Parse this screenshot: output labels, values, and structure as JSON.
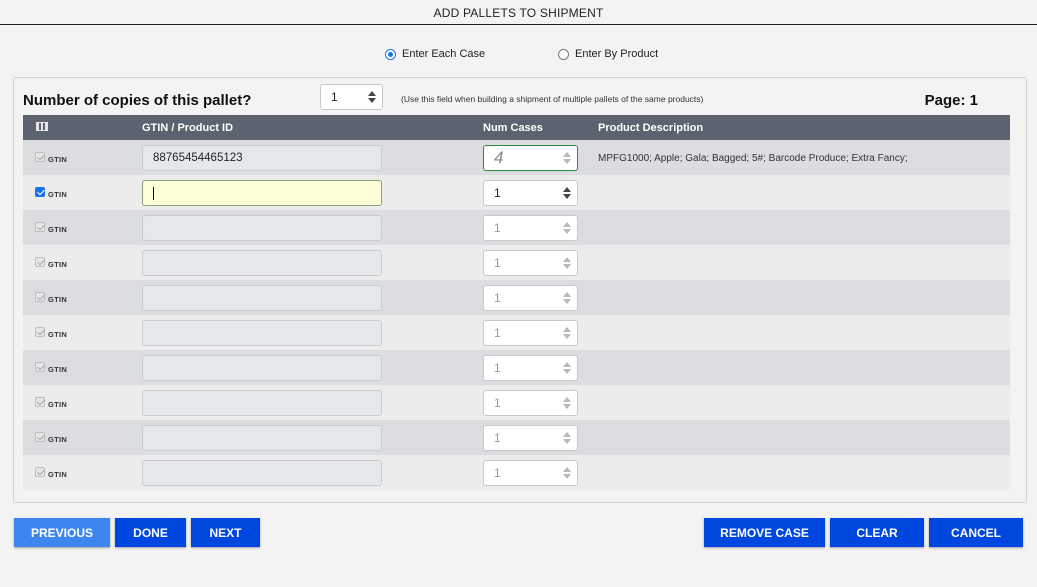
{
  "window": {
    "title": "ADD PALLETS TO SHIPMENT"
  },
  "mode": {
    "options": [
      {
        "label": "Enter Each Case",
        "selected": true
      },
      {
        "label": "Enter By Product",
        "selected": false
      }
    ]
  },
  "copies": {
    "label": "Number of copies of this pallet?",
    "value": "1",
    "hint": "(Use this field when building a shipment of multiple pallets of the same products)"
  },
  "page": {
    "label": "Page: 1"
  },
  "grid": {
    "headers": {
      "gtin": "GTIN / Product ID",
      "cases": "Num Cases",
      "description": "Product Description"
    },
    "rows": [
      {
        "type": "GTIN",
        "gtin": "88765454465123",
        "cases": "4",
        "description": "MPFG1000; Apple; Gala; Bagged; 5#; Barcode Produce; Extra Fancy;"
      },
      {
        "type": "GTIN",
        "gtin": "",
        "cases": "1",
        "description": ""
      },
      {
        "type": "GTIN",
        "gtin": "",
        "cases": "1",
        "description": ""
      },
      {
        "type": "GTIN",
        "gtin": "",
        "cases": "1",
        "description": ""
      },
      {
        "type": "GTIN",
        "gtin": "",
        "cases": "1",
        "description": ""
      },
      {
        "type": "GTIN",
        "gtin": "",
        "cases": "1",
        "description": ""
      },
      {
        "type": "GTIN",
        "gtin": "",
        "cases": "1",
        "description": ""
      },
      {
        "type": "GTIN",
        "gtin": "",
        "cases": "1",
        "description": ""
      },
      {
        "type": "GTIN",
        "gtin": "",
        "cases": "1",
        "description": ""
      },
      {
        "type": "GTIN",
        "gtin": "",
        "cases": "1",
        "description": ""
      }
    ]
  },
  "buttons": {
    "previous": "PREVIOUS",
    "done": "DONE",
    "next": "NEXT",
    "remove_case": "REMOVE CASE",
    "clear": "CLEAR",
    "cancel": "CANCEL"
  },
  "colors": {
    "primary_button": "#0047e0",
    "secondary_button": "#3d86f0",
    "header": "#5c6370",
    "focus_field": "#fdfdd6"
  }
}
